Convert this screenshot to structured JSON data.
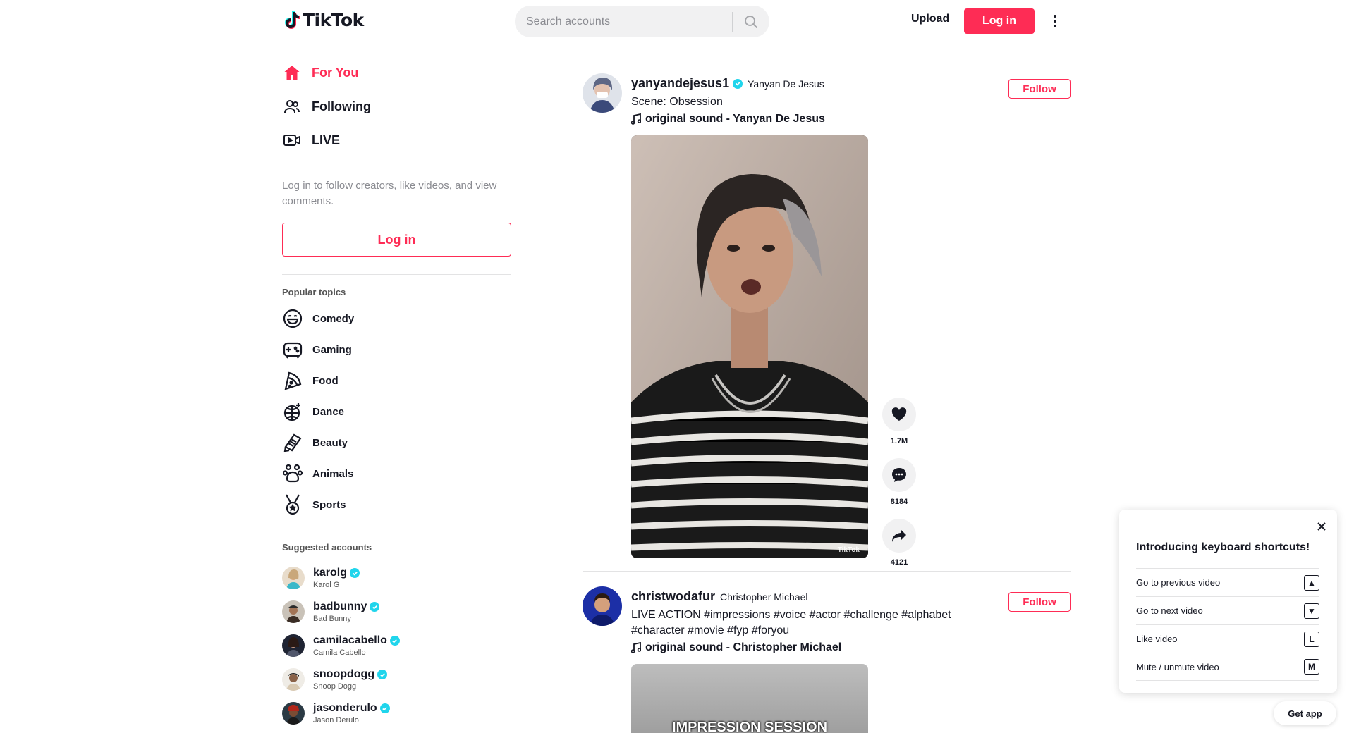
{
  "header": {
    "logo_text": "TikTok",
    "search_placeholder": "Search accounts",
    "upload_label": "Upload",
    "login_label": "Log in"
  },
  "sidebar": {
    "nav": [
      {
        "label": "For You",
        "icon": "home-icon",
        "active": true
      },
      {
        "label": "Following",
        "icon": "users-icon",
        "active": false
      },
      {
        "label": "LIVE",
        "icon": "live-camera-icon",
        "active": false
      }
    ],
    "login_hint": "Log in to follow creators, like videos, and view comments.",
    "login_label": "Log in",
    "topics_title": "Popular topics",
    "topics": [
      {
        "label": "Comedy",
        "icon": "comedy-face-icon"
      },
      {
        "label": "Gaming",
        "icon": "gamepad-icon"
      },
      {
        "label": "Food",
        "icon": "pizza-icon"
      },
      {
        "label": "Dance",
        "icon": "disco-ball-icon"
      },
      {
        "label": "Beauty",
        "icon": "comb-icon"
      },
      {
        "label": "Animals",
        "icon": "paw-icon"
      },
      {
        "label": "Sports",
        "icon": "medal-icon"
      }
    ],
    "suggested_title": "Suggested accounts",
    "accounts": [
      {
        "username": "karolg",
        "nickname": "Karol G",
        "color": "#c9a77a"
      },
      {
        "username": "badbunny",
        "nickname": "Bad Bunny",
        "color": "#6b4a3a"
      },
      {
        "username": "camilacabello",
        "nickname": "Camila Cabello",
        "color": "#2c3140"
      },
      {
        "username": "snoopdogg",
        "nickname": "Snoop Dogg",
        "color": "#b9a48a"
      },
      {
        "username": "jasonderulo",
        "nickname": "Jason Derulo",
        "color": "#8a2a1c"
      }
    ]
  },
  "feed": {
    "posts": [
      {
        "username": "yanyandejesus1",
        "nickname": "Yanyan De Jesus",
        "caption": "Scene: Obsession",
        "music": "original sound - Yanyan De Jesus",
        "follow_label": "Follow",
        "likes": "1.7M",
        "comments": "8184",
        "shares": "4121",
        "watermark": "TikTok"
      },
      {
        "username": "christwodafur",
        "nickname": "Christopher Michael",
        "caption": "LIVE ACTION #impressions #voice #actor #challenge #alphabet #character #movie #fyp #foryou",
        "music": "original sound - Christopher Michael",
        "follow_label": "Follow",
        "video_overlay": "IMPRESSION SESSION"
      }
    ]
  },
  "shortcuts": {
    "title": "Introducing keyboard shortcuts!",
    "items": [
      {
        "label": "Go to previous video",
        "key": "▲"
      },
      {
        "label": "Go to next video",
        "key": "▼"
      },
      {
        "label": "Like video",
        "key": "L"
      },
      {
        "label": "Mute / unmute video",
        "key": "M"
      }
    ]
  },
  "get_app_label": "Get app",
  "colors": {
    "brand": "#fe2c55",
    "verified": "#20d5ec",
    "text": "#161823",
    "muted": "#8a8b91"
  }
}
